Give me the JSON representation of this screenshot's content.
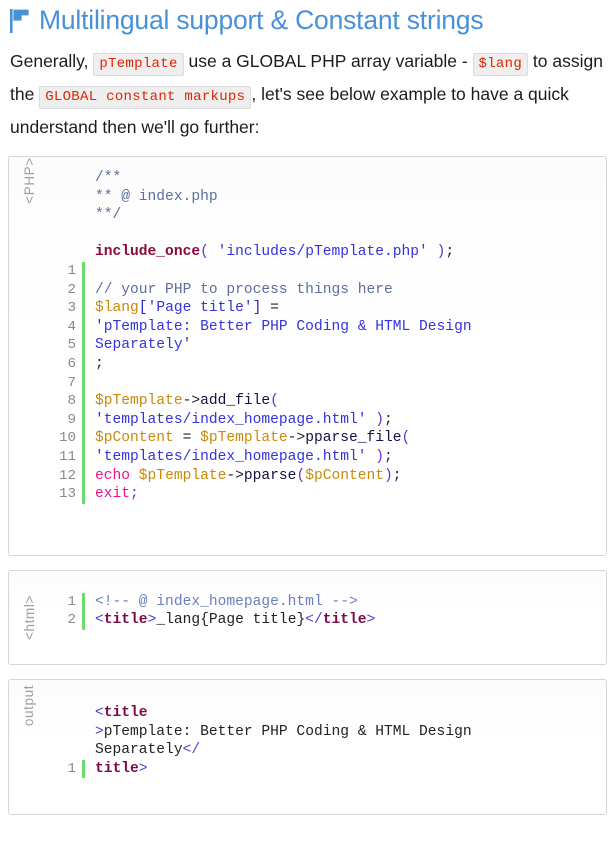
{
  "header": {
    "icon": "flag-icon",
    "icon_color": "#4a90d9",
    "title": "Multilingual support & Constant strings",
    "title_color": "#4a90d9"
  },
  "intro": {
    "part1": "Generally, ",
    "code1": "pTemplate",
    "part2": " use a GLOBAL PHP array variable - ",
    "code2": "$lang",
    "part3": " to assign the ",
    "code3": "GLOBAL constant markups",
    "part4": ", let's see below example to have a quick understand then we'll go further:",
    "code_color": "#e32400",
    "code_background": "#eeeeee"
  },
  "panels": [
    {
      "label": "<PHP>",
      "gutter_color": "#6edb6e",
      "lines": [
        {
          "num": "",
          "gutter": false,
          "text": "/**"
        },
        {
          "num": "",
          "gutter": false,
          "text": "** @ index.php"
        },
        {
          "num": "",
          "gutter": false,
          "text": "**/"
        },
        {
          "num": "",
          "gutter": false,
          "text": ""
        },
        {
          "num": "",
          "gutter": false,
          "text": "include_once( 'includes/pTemplate.php' );"
        },
        {
          "num": "1",
          "gutter": true,
          "text": ""
        },
        {
          "num": "2",
          "gutter": true,
          "text": "// your PHP to process things here"
        },
        {
          "num": "3",
          "gutter": true,
          "text": "$lang['Page title'] ="
        },
        {
          "num": "4",
          "gutter": true,
          "text": "'pTemplate: Better PHP Coding & HTML Design"
        },
        {
          "num": "5",
          "gutter": true,
          "text": "Separately'"
        },
        {
          "num": "6",
          "gutter": true,
          "text": ";"
        },
        {
          "num": "7",
          "gutter": true,
          "text": ""
        },
        {
          "num": "8",
          "gutter": true,
          "text": "$pTemplate->add_file("
        },
        {
          "num": "9",
          "gutter": true,
          "text": "'templates/index_homepage.html' );"
        },
        {
          "num": "10",
          "gutter": true,
          "text": "$pContent = $pTemplate->pparse_file("
        },
        {
          "num": "11",
          "gutter": true,
          "text": "'templates/index_homepage.html' );"
        },
        {
          "num": "12",
          "gutter": true,
          "text": "echo $pTemplate->pparse($pContent);"
        },
        {
          "num": "13",
          "gutter": true,
          "text": "exit;"
        }
      ]
    },
    {
      "label": "<html>",
      "gutter_color": "#6edb6e",
      "lines": [
        {
          "num": "1",
          "gutter": true,
          "text": "<!-- @ index_homepage.html -->"
        },
        {
          "num": "2",
          "gutter": true,
          "text": "<title>_lang{Page title}</title>"
        }
      ]
    },
    {
      "label": "output",
      "gutter_color": "#6edb6e",
      "lines": [
        {
          "num": "",
          "gutter": false,
          "text": "<title"
        },
        {
          "num": "",
          "gutter": false,
          "text": ">pTemplate: Better PHP Coding & HTML Design"
        },
        {
          "num": "",
          "gutter": false,
          "text": "Separately</"
        },
        {
          "num": "1",
          "gutter": true,
          "text": "title>"
        }
      ]
    }
  ]
}
